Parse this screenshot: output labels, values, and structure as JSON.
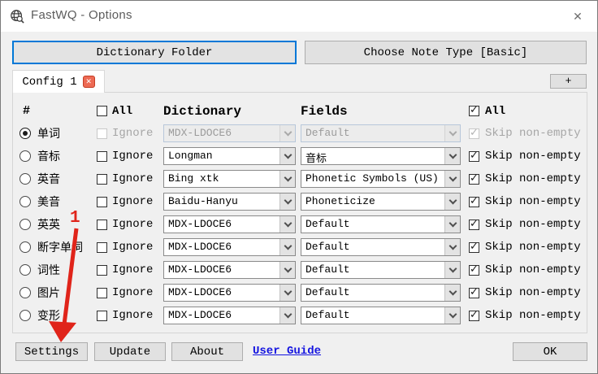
{
  "window": {
    "title": "FastWQ - Options",
    "close_glyph": "✕"
  },
  "toolbar": {
    "dictionary_folder": "Dictionary Folder",
    "choose_note_type": "Choose Note Type [Basic]"
  },
  "tabs": {
    "active_label": "Config 1",
    "close_glyph": "✕",
    "add_label": "+"
  },
  "table": {
    "headers": {
      "index": "#",
      "all_left": "All",
      "dictionary": "Dictionary",
      "fields": "Fields",
      "all_right": "All"
    },
    "header_all_left_checked": false,
    "header_all_right_checked": true,
    "labels": {
      "ignore": "Ignore",
      "skip": "Skip non-empty"
    },
    "rows": [
      {
        "name": "单词",
        "selected": true,
        "enabled": false,
        "ignore_checked": false,
        "dictionary": "MDX-LDOCE6",
        "field": "Default",
        "skip_checked": true
      },
      {
        "name": "音标",
        "selected": false,
        "enabled": true,
        "ignore_checked": false,
        "dictionary": "Longman",
        "field": "音标",
        "skip_checked": true
      },
      {
        "name": "英音",
        "selected": false,
        "enabled": true,
        "ignore_checked": false,
        "dictionary": "Bing xtk",
        "field": "Phonetic Symbols (US)",
        "skip_checked": true
      },
      {
        "name": "美音",
        "selected": false,
        "enabled": true,
        "ignore_checked": false,
        "dictionary": "Baidu-Hanyu",
        "field": "Phoneticize",
        "skip_checked": true
      },
      {
        "name": "英英",
        "selected": false,
        "enabled": true,
        "ignore_checked": false,
        "dictionary": "MDX-LDOCE6",
        "field": "Default",
        "skip_checked": true
      },
      {
        "name": "断字单词",
        "selected": false,
        "enabled": true,
        "ignore_checked": false,
        "dictionary": "MDX-LDOCE6",
        "field": "Default",
        "skip_checked": true
      },
      {
        "name": "词性",
        "selected": false,
        "enabled": true,
        "ignore_checked": false,
        "dictionary": "MDX-LDOCE6",
        "field": "Default",
        "skip_checked": true
      },
      {
        "name": "图片",
        "selected": false,
        "enabled": true,
        "ignore_checked": false,
        "dictionary": "MDX-LDOCE6",
        "field": "Default",
        "skip_checked": true
      },
      {
        "name": "变形",
        "selected": false,
        "enabled": true,
        "ignore_checked": false,
        "dictionary": "MDX-LDOCE6",
        "field": "Default",
        "skip_checked": true
      }
    ]
  },
  "footer": {
    "settings": "Settings",
    "update": "Update",
    "about": "About",
    "user_guide": "User Guide",
    "ok": "OK"
  },
  "annotation": {
    "label": "1"
  },
  "colors": {
    "focus_blue": "#0078d7",
    "annotation_red": "#e0241a",
    "link_blue": "#1414e0",
    "tab_close_red": "#ed6a54",
    "dialog_bg": "#f0f0f0"
  }
}
